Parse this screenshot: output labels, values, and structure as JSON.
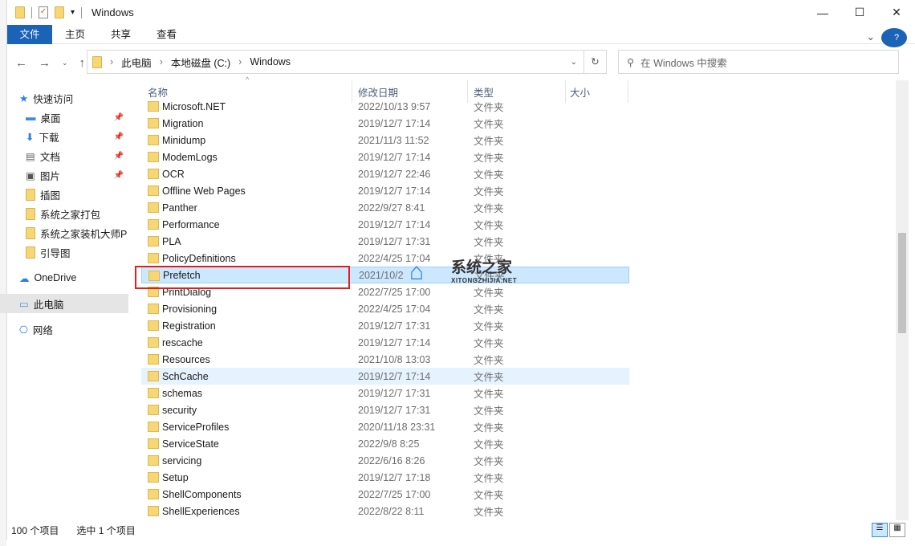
{
  "window": {
    "title": "Windows",
    "min": "—",
    "max": "☐",
    "close": "✕"
  },
  "ribbon": {
    "tabs": [
      "文件",
      "主页",
      "共享",
      "查看"
    ],
    "help": "?"
  },
  "address": {
    "crumbs": [
      "此电脑",
      "本地磁盘 (C:)",
      "Windows"
    ],
    "refresh": "↻"
  },
  "search": {
    "placeholder": "在 Windows 中搜索"
  },
  "sidebar": {
    "items": [
      {
        "label": "快速访问",
        "type": "top",
        "pinned": false
      },
      {
        "label": "桌面",
        "type": "sub",
        "pinned": true
      },
      {
        "label": "下载",
        "type": "sub",
        "pinned": true
      },
      {
        "label": "文档",
        "type": "sub",
        "pinned": true
      },
      {
        "label": "图片",
        "type": "sub",
        "pinned": true
      },
      {
        "label": "插图",
        "type": "sub",
        "pinned": false
      },
      {
        "label": "系统之家打包",
        "type": "sub",
        "pinned": false
      },
      {
        "label": "系统之家装机大师P",
        "type": "sub",
        "pinned": false
      },
      {
        "label": "引导图",
        "type": "sub",
        "pinned": false
      },
      {
        "label": "OneDrive",
        "type": "top",
        "pinned": false
      },
      {
        "label": "此电脑",
        "type": "top",
        "pinned": false
      },
      {
        "label": "网络",
        "type": "top",
        "pinned": false
      }
    ]
  },
  "columns": {
    "name": "名称",
    "date": "修改日期",
    "type": "类型",
    "size": "大小"
  },
  "files": [
    {
      "name": "Microsoft.NET",
      "date": "2022/10/13 9:57",
      "type": "文件夹"
    },
    {
      "name": "Migration",
      "date": "2019/12/7 17:14",
      "type": "文件夹"
    },
    {
      "name": "Minidump",
      "date": "2021/11/3 11:52",
      "type": "文件夹"
    },
    {
      "name": "ModemLogs",
      "date": "2019/12/7 17:14",
      "type": "文件夹"
    },
    {
      "name": "OCR",
      "date": "2019/12/7 22:46",
      "type": "文件夹"
    },
    {
      "name": "Offline Web Pages",
      "date": "2019/12/7 17:14",
      "type": "文件夹"
    },
    {
      "name": "Panther",
      "date": "2022/9/27 8:41",
      "type": "文件夹"
    },
    {
      "name": "Performance",
      "date": "2019/12/7 17:14",
      "type": "文件夹"
    },
    {
      "name": "PLA",
      "date": "2019/12/7 17:31",
      "type": "文件夹"
    },
    {
      "name": "PolicyDefinitions",
      "date": "2022/4/25 17:04",
      "type": "文件夹"
    },
    {
      "name": "Prefetch",
      "date": "2021/10/2",
      "type": "文件夹",
      "state": "sel"
    },
    {
      "name": "PrintDialog",
      "date": "2022/7/25 17:00",
      "type": "文件夹"
    },
    {
      "name": "Provisioning",
      "date": "2022/4/25 17:04",
      "type": "文件夹"
    },
    {
      "name": "Registration",
      "date": "2019/12/7 17:31",
      "type": "文件夹"
    },
    {
      "name": "rescache",
      "date": "2019/12/7 17:14",
      "type": "文件夹"
    },
    {
      "name": "Resources",
      "date": "2021/10/8 13:03",
      "type": "文件夹"
    },
    {
      "name": "SchCache",
      "date": "2019/12/7 17:14",
      "type": "文件夹",
      "state": "hov"
    },
    {
      "name": "schemas",
      "date": "2019/12/7 17:31",
      "type": "文件夹"
    },
    {
      "name": "security",
      "date": "2019/12/7 17:31",
      "type": "文件夹"
    },
    {
      "name": "ServiceProfiles",
      "date": "2020/11/18 23:31",
      "type": "文件夹"
    },
    {
      "name": "ServiceState",
      "date": "2022/9/8 8:25",
      "type": "文件夹"
    },
    {
      "name": "servicing",
      "date": "2022/6/16 8:26",
      "type": "文件夹"
    },
    {
      "name": "Setup",
      "date": "2019/12/7 17:18",
      "type": "文件夹"
    },
    {
      "name": "ShellComponents",
      "date": "2022/7/25 17:00",
      "type": "文件夹"
    },
    {
      "name": "ShellExperiences",
      "date": "2022/8/22 8:11",
      "type": "文件夹"
    }
  ],
  "watermark": {
    "title": "系统之家",
    "url": "XITONGZHIJIA.NET"
  },
  "status": {
    "count": "100 个项目",
    "selected": "选中 1 个项目"
  }
}
